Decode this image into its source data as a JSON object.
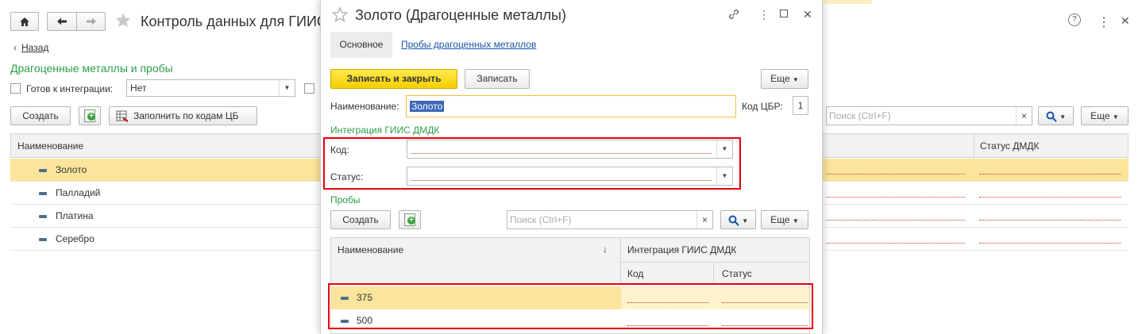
{
  "background": {
    "title": "Контроль данных для ГИИС ДМДК",
    "back_label": "Назад",
    "section_title": "Драгоценные металлы и пробы",
    "ready_label": "Готов к интеграции:",
    "ready_value": "Нет",
    "buttons": {
      "create": "Создать",
      "fill_cb": "Заполнить по кодам ЦБ",
      "more": "Еще"
    },
    "search_placeholder": "Поиск (Ctrl+F)",
    "table": {
      "col_name": "Наименование",
      "col_status": "Статус ДМДК",
      "rows": [
        "Золото",
        "Палладий",
        "Платина",
        "Серебро"
      ]
    }
  },
  "modal": {
    "title": "Золото (Драгоценные металлы)",
    "tabs": {
      "main": "Основное",
      "probes": "Пробы драгоценных металлов"
    },
    "buttons": {
      "save_close": "Записать и закрыть",
      "save": "Записать",
      "more": "Еще"
    },
    "name_label": "Наименование:",
    "name_value": "Золото",
    "cbr_label": "Код ЦБР:",
    "cbr_value": "1",
    "integration_title": "Интеграция ГИИС ДМДК",
    "code_label": "Код:",
    "status_label": "Статус:",
    "probes_title": "Пробы",
    "probes_buttons": {
      "create": "Создать",
      "more": "Еще"
    },
    "probes_search_placeholder": "Поиск (Ctrl+F)",
    "probes_table": {
      "col_name": "Наименование",
      "sort_indicator": "↓",
      "col_group": "Интеграция ГИИС ДМДК",
      "col_code": "Код",
      "col_status": "Статус",
      "rows": [
        "375",
        "500"
      ]
    }
  },
  "colors": {
    "accent_green": "#2b9e4a",
    "selection_yellow": "#fbe59a",
    "primary_button": "#f3cf00",
    "highlight_red": "#e8000d",
    "link_blue": "#1a53a8"
  }
}
